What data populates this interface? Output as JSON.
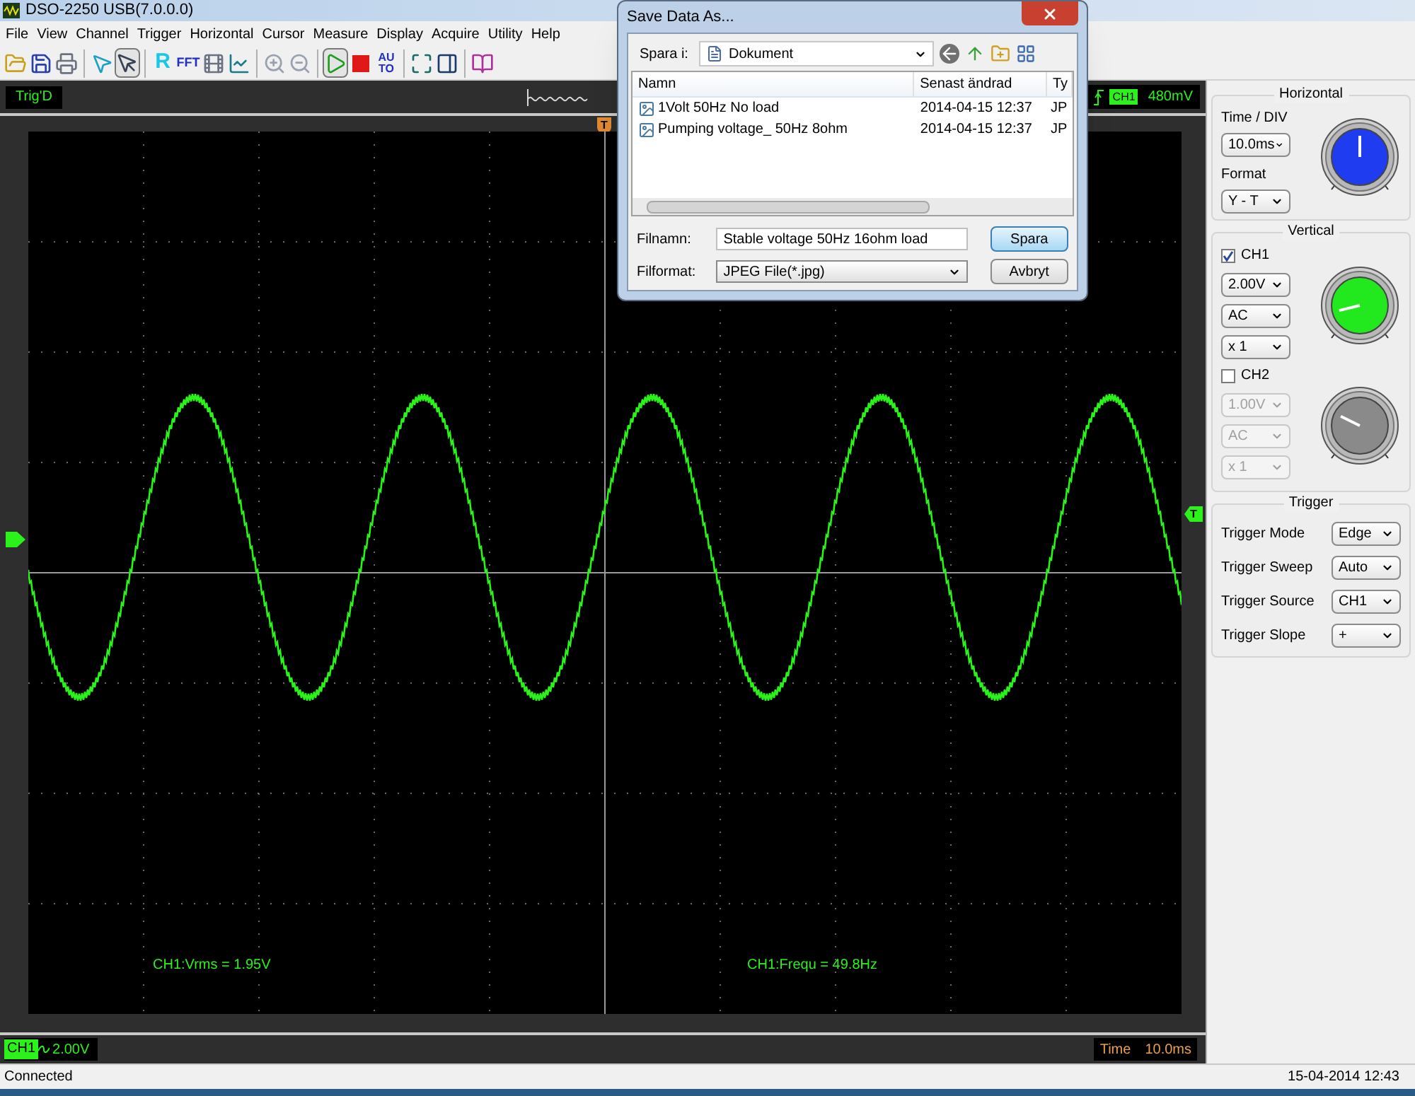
{
  "window": {
    "title": "DSO-2250 USB(7.0.0.0)"
  },
  "menu": [
    "File",
    "View",
    "Channel",
    "Trigger",
    "Horizontal",
    "Cursor",
    "Measure",
    "Display",
    "Acquire",
    "Utility",
    "Help"
  ],
  "toolbar": [
    {
      "kind": "open",
      "selected": false
    },
    {
      "kind": "save",
      "selected": false
    },
    {
      "kind": "print",
      "selected": false
    },
    {
      "kind": "sep"
    },
    {
      "kind": "cursor-select",
      "selected": false
    },
    {
      "kind": "pointer",
      "selected": true
    },
    {
      "kind": "sep"
    },
    {
      "kind": "text",
      "label": "R",
      "selected": false
    },
    {
      "kind": "text",
      "label": "FFT",
      "selected": false
    },
    {
      "kind": "film",
      "selected": false
    },
    {
      "kind": "chart",
      "selected": false
    },
    {
      "kind": "sep"
    },
    {
      "kind": "zoom-in",
      "selected": false
    },
    {
      "kind": "zoom-out",
      "selected": false
    },
    {
      "kind": "sep"
    },
    {
      "kind": "play",
      "selected": true
    },
    {
      "kind": "stop",
      "selected": false
    },
    {
      "kind": "text",
      "label": "AUTO",
      "selected": false
    },
    {
      "kind": "sep"
    },
    {
      "kind": "fullscreen",
      "selected": false
    },
    {
      "kind": "panel",
      "selected": false
    },
    {
      "kind": "sep"
    },
    {
      "kind": "book",
      "selected": false
    }
  ],
  "top_strip": {
    "status": "Trig'D",
    "trigger_channel": "CH1",
    "trigger_level": "480mV"
  },
  "scope": {
    "trigger_position_marker": "T",
    "trigger_level_marker": "T",
    "measurements": [
      {
        "text": "CH1:Vrms = 1.95V"
      },
      {
        "text": "CH1:Frequ = 49.8Hz"
      }
    ]
  },
  "bottom_strip": {
    "channel": "CH1",
    "scale": "2.00V",
    "time_label": "Time",
    "time_value": "10.0ms"
  },
  "status_bar": {
    "connection": "Connected",
    "datetime": "15-04-2014 12:43"
  },
  "panel": {
    "horizontal": {
      "title": "Horizontal",
      "time_div_label": "Time / DIV",
      "time_div": "10.0ms",
      "format_label": "Format",
      "format": "Y - T"
    },
    "vertical": {
      "title": "Vertical",
      "channels": [
        {
          "name": "CH1",
          "checked": true,
          "color": "#22e81e",
          "volts": "2.00V",
          "coupling": "AC",
          "probe": "x 1"
        },
        {
          "name": "CH2",
          "checked": false,
          "color": "#8a8a8a",
          "volts": "1.00V",
          "coupling": "AC",
          "probe": "x 1"
        }
      ]
    },
    "trigger": {
      "title": "Trigger",
      "rows": [
        {
          "label": "Trigger Mode",
          "value": "Edge"
        },
        {
          "label": "Trigger Sweep",
          "value": "Auto"
        },
        {
          "label": "Trigger Source",
          "value": "CH1"
        },
        {
          "label": "Trigger Slope",
          "value": "+"
        }
      ]
    }
  },
  "dialog": {
    "title": "Save Data As...",
    "save_in_label": "Spara i:",
    "save_in": "Dokument",
    "columns": [
      "Namn",
      "Senast ändrad",
      "Ty"
    ],
    "files": [
      {
        "name": "1Volt 50Hz No load",
        "modified": "2014-04-15 12:37",
        "type": "JP"
      },
      {
        "name": "Pumping voltage_ 50Hz  8ohm",
        "modified": "2014-04-15 12:37",
        "type": "JP"
      }
    ],
    "filename_label": "Filnamn:",
    "filename": "Stable voltage 50Hz 16ohm load",
    "format_label": "Filformat:",
    "format": "JPEG File(*.jpg)",
    "buttons": [
      {
        "label": "Spara",
        "kind": "primary"
      },
      {
        "label": "Avbryt",
        "kind": "normal"
      }
    ]
  }
}
